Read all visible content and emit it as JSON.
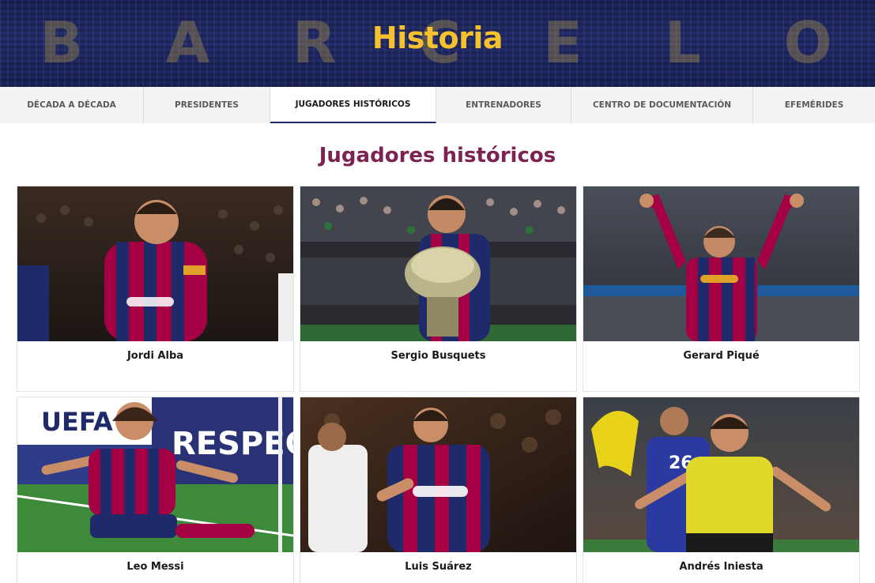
{
  "hero": {
    "title": "Historia",
    "stadium_letters": [
      "B",
      "A",
      "R",
      "C",
      "E",
      "L",
      "O"
    ]
  },
  "tabs": [
    {
      "label": "DÉCADA A DÉCADA"
    },
    {
      "label": "PRESIDENTES"
    },
    {
      "label": "JUGADORES HISTÓRICOS",
      "active": true
    },
    {
      "label": "ENTRENADORES"
    },
    {
      "label": "CENTRO DE DOCUMENTACIÓN"
    },
    {
      "label": "EFEMÉRIDES"
    }
  ],
  "section": {
    "title": "Jugadores históricos"
  },
  "players": [
    {
      "name": "Jordi Alba"
    },
    {
      "name": "Sergio Busquets"
    },
    {
      "name": "Gerard Piqué"
    },
    {
      "name": "Leo Messi"
    },
    {
      "name": "Luis Suárez"
    },
    {
      "name": "Andrés Iniesta"
    }
  ],
  "colors": {
    "accent_gold": "#f5c12e",
    "title_maroon": "#7d2353",
    "blaugrana_blue": "#1f2a6b",
    "blaugrana_red": "#a50044"
  }
}
